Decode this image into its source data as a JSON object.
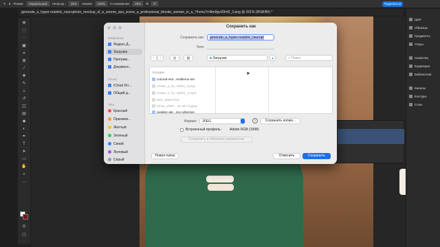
{
  "app": {
    "options": {
      "mode_label": "Режим:",
      "mode_value": "Нормальный",
      "opacity_label": "Непрозр.:",
      "opacity_value": "25%",
      "flow_label": "Нажим:",
      "flow_value": "100%",
      "smoothing_label": "Сглаживание:",
      "smoothing_value": "25%",
      "angle_value": "0°",
      "share_label": "Поделиться"
    },
    "document_tab": "generate_a_hyper-realistic_neurophoto_mockup_of_a_serene_spa_scene_a_professional_blonde_woman_in_a_74vmu7rr4bn9gvi29r42_2.png @ 201% (RGB/8#) *",
    "right_panel": [
      "Цвет",
      "Образцы",
      "Градиенты",
      "Узоры",
      "Свойства",
      "Коррекция",
      "Библиотеки",
      "Каналы",
      "Контуры",
      "Слои"
    ]
  },
  "dialog": {
    "title": "Сохранить как",
    "sidebar": {
      "favorites_heading": "Избранное",
      "favorites": [
        "Яндекс.Д...",
        "Загрузки",
        "Програм...",
        "Документ..."
      ],
      "icloud_heading": "iCloud",
      "icloud": [
        "iCloud Dri...",
        "Общий д..."
      ],
      "tags_heading": "Теги",
      "tags": [
        {
          "label": "Красный",
          "color": "#ff4f4f"
        },
        {
          "label": "Оранжев...",
          "color": "#ff9a2e"
        },
        {
          "label": "Желтый",
          "color": "#f5c518"
        },
        {
          "label": "Зеленый",
          "color": "#34c759"
        },
        {
          "label": "Синий",
          "color": "#3b82f6"
        },
        {
          "label": "Лиловый",
          "color": "#a259e6"
        },
        {
          "label": "Серый",
          "color": "#9b9b9b"
        }
      ]
    },
    "save_as_label": "Сохранить как:",
    "save_as_value": "generate_a_hyper-realistic_neuropl",
    "tags_label": "Теги:",
    "location": "Загрузки",
    "search_placeholder": "Поиск",
    "files_heading": "Сегодня",
    "files": [
      {
        "name": "colored-vint...emblems-set",
        "dim": false
      },
      {
        "name": "create_a_hy...k83m_0.png",
        "dim": true
      },
      {
        "name": "create_a_hy...6j69i1_3.mp4",
        "dim": true
      },
      {
        "name": "IMG_8465.PNG",
        "dim": true
      },
      {
        "name": "photo_2025....11-46-13.jpeg",
        "dim": true
      },
      {
        "name": "realistic-ukr...ms-collection",
        "dim": false
      }
    ],
    "format_label": "Формат:",
    "format_value": "JPEG",
    "save_copy_label": "Сохранить копию...",
    "embed_profile_label": "Встроенный профиль:",
    "embed_profile_value": "Adobe RGB (1998)",
    "cloud_save_label": "Сохранить в облачных документах",
    "new_folder_label": "Новая папка",
    "cancel_label": "Отменить",
    "save_label": "Сохранить"
  }
}
